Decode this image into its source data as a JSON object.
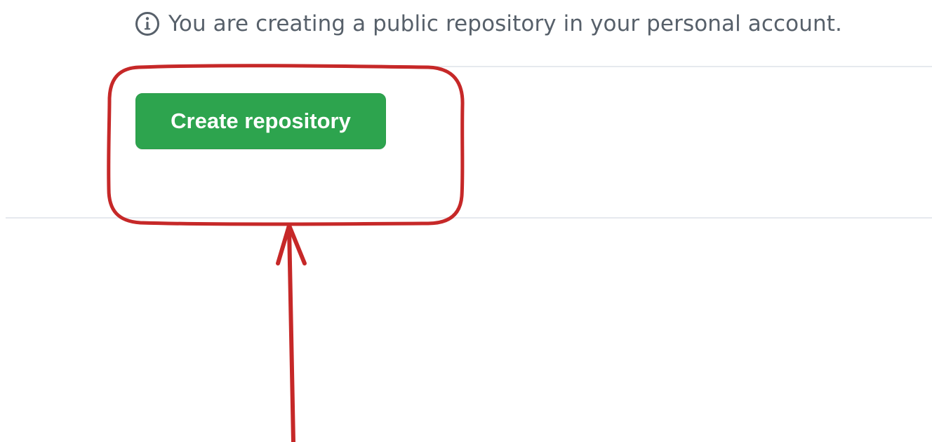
{
  "notice": {
    "icon": "info-icon",
    "text": "You are creating a public repository in your personal account."
  },
  "actions": {
    "create_label": "Create repository"
  },
  "colors": {
    "primary_button": "#2da44e",
    "notice_text": "#57606a",
    "divider": "#e6e9ee",
    "annotation": "#c62828"
  }
}
